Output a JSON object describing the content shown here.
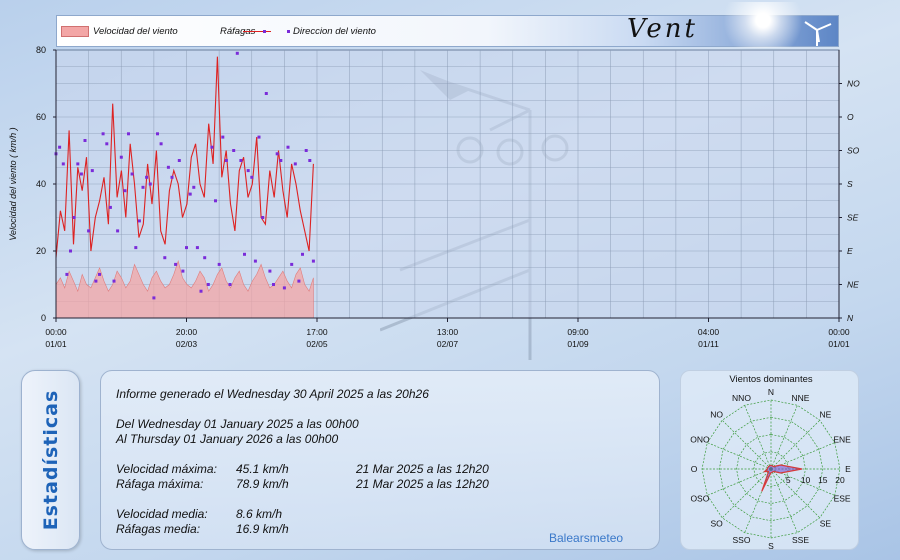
{
  "legend": {
    "velocidad": "Velocidad del viento",
    "rafagas": "Ráfagas",
    "direccion": "Direccion del viento",
    "title": "Vent"
  },
  "colors": {
    "fill": "#f3a6a6",
    "gust": "#dd2222",
    "direction": "#7a2bd9",
    "accent": "#1e63b8"
  },
  "chart_data": [
    {
      "type": "line",
      "ylabel": "Velocidad del viento  ( km/h )",
      "ylim": [
        0,
        80
      ],
      "yticks": [
        "0",
        "20",
        "40",
        "60",
        "80"
      ],
      "y2ticks": [
        "N",
        "NE",
        "E",
        "SE",
        "S",
        "SO",
        "O",
        "NO"
      ],
      "xticks": [
        {
          "time": "00:00",
          "date": "01/01"
        },
        {
          "time": "20:00",
          "date": "02/03"
        },
        {
          "time": "17:00",
          "date": "02/05"
        },
        {
          "time": "13:00",
          "date": "02/07"
        },
        {
          "time": "09:00",
          "date": "01/09"
        },
        {
          "time": "04:00",
          "date": "01/11"
        },
        {
          "time": "00:00",
          "date": "01/01"
        }
      ],
      "x_range_days": [
        0,
        365
      ],
      "data_end_day": 120,
      "grid": true,
      "series": [
        {
          "name": "Velocidad del viento",
          "kind": "area",
          "values": [
            10,
            12,
            9,
            14,
            11,
            8,
            13,
            10,
            9,
            12,
            15,
            11,
            8,
            10,
            14,
            12,
            9,
            11,
            16,
            13,
            10,
            8,
            12,
            14,
            11,
            9,
            10,
            13,
            17,
            12,
            10,
            9,
            11,
            14,
            12,
            8,
            10,
            13,
            15,
            11,
            9,
            12,
            14,
            10,
            8,
            11,
            13,
            16,
            12,
            9,
            10,
            12,
            14,
            11,
            9,
            13,
            15,
            10,
            8,
            12
          ]
        },
        {
          "name": "Ráfagas",
          "kind": "line",
          "values": [
            18,
            32,
            26,
            56,
            22,
            45,
            38,
            48,
            20,
            30,
            35,
            42,
            28,
            64,
            36,
            44,
            30,
            52,
            40,
            24,
            28,
            46,
            34,
            50,
            26,
            22,
            38,
            44,
            40,
            30,
            34,
            48,
            52,
            40,
            36,
            58,
            46,
            78,
            42,
            50,
            34,
            26,
            44,
            48,
            36,
            40,
            54,
            30,
            28,
            44,
            36,
            50,
            38,
            30,
            46,
            40,
            32,
            26,
            20,
            46
          ]
        },
        {
          "name": "Direccion del viento",
          "kind": "scatter",
          "values": [
            49,
            51,
            46,
            13,
            20,
            30,
            46,
            43,
            53,
            26,
            44,
            11,
            13,
            55,
            52,
            33,
            11,
            26,
            48,
            38,
            55,
            43,
            21,
            29,
            39,
            42,
            40,
            6,
            55,
            52,
            18,
            45,
            42,
            16,
            47,
            14,
            21,
            37,
            39,
            21,
            8,
            18,
            10,
            51,
            35,
            16,
            54,
            47,
            10,
            50,
            79,
            47,
            19,
            44,
            42,
            17,
            54,
            30,
            67,
            14,
            10,
            49,
            47,
            9,
            51,
            16,
            46,
            11,
            19,
            50,
            47,
            17
          ]
        }
      ]
    },
    {
      "type": "radar",
      "title": "Vientos dominantes",
      "directions": [
        "N",
        "NNE",
        "NE",
        "ENE",
        "E",
        "ESE",
        "SE",
        "SSE",
        "S",
        "SSO",
        "SO",
        "OSO",
        "O",
        "ONO",
        "NO",
        "NNO"
      ],
      "rings": [
        "5",
        "10",
        "15",
        "20"
      ],
      "rlim": [
        0,
        20
      ],
      "values": [
        1,
        1,
        1,
        3,
        9,
        3,
        1,
        1,
        1,
        7,
        1,
        2,
        1,
        1,
        1,
        1
      ]
    }
  ],
  "stats": {
    "tab_label": "Estadísticas",
    "report_line": "Informe generado el Wednesday 30 April 2025 a las 20h26",
    "from_line": "Del Wednesday 01 January 2025 a las 00h00",
    "to_line": "Al Thursday 01 January 2026 a las 00h00",
    "rows": [
      {
        "label": "Velocidad máxima:",
        "value": "45.1 km/h",
        "when": "21 Mar 2025 a las 12h20"
      },
      {
        "label": "Ráfaga máxima:",
        "value": "78.9 km/h",
        "when": "21 Mar 2025 a las 12h20"
      },
      {
        "label": "Velocidad media:",
        "value": "8.6 km/h",
        "when": ""
      },
      {
        "label": "Ráfagas media:",
        "value": "16.9 km/h",
        "when": ""
      }
    ],
    "brand": "Balearsmeteo"
  }
}
